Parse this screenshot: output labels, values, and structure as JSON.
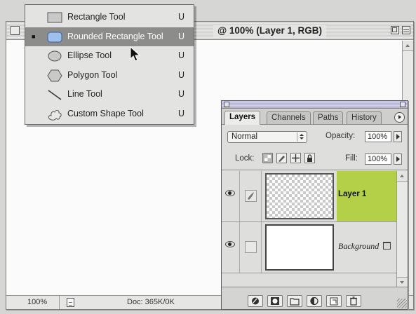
{
  "document": {
    "title_visible": "@ 100% (Layer 1, RGB)",
    "zoom": "100%",
    "doc_size": "Doc: 365K/0K"
  },
  "tool_menu": {
    "items": [
      {
        "label": "Rectangle Tool",
        "shortcut": "U",
        "icon": "rectangle-shape-icon",
        "selected": false
      },
      {
        "label": "Rounded Rectangle Tool",
        "shortcut": "U",
        "icon": "rounded-rectangle-shape-icon",
        "selected": true,
        "check": "■"
      },
      {
        "label": "Ellipse Tool",
        "shortcut": "U",
        "icon": "ellipse-shape-icon",
        "selected": false
      },
      {
        "label": "Polygon Tool",
        "shortcut": "U",
        "icon": "polygon-shape-icon",
        "selected": false
      },
      {
        "label": "Line Tool",
        "shortcut": "U",
        "icon": "line-shape-icon",
        "selected": false
      },
      {
        "label": "Custom Shape Tool",
        "shortcut": "U",
        "icon": "custom-shape-icon",
        "selected": false
      }
    ]
  },
  "layers_panel": {
    "tabs": [
      "Layers",
      "Channels",
      "Paths",
      "History"
    ],
    "active_tab": "Layers",
    "blend_mode": "Normal",
    "opacity_label": "Opacity:",
    "opacity_value": "100%",
    "lock_label": "Lock:",
    "fill_label": "Fill:",
    "fill_value": "100%",
    "layers": [
      {
        "name": "Layer 1",
        "selected": true,
        "thumbnail": "transparent",
        "visible": true
      },
      {
        "name": "Background",
        "selected": false,
        "thumbnail": "white",
        "visible": true,
        "locked": true
      }
    ]
  },
  "colors": {
    "selected_layer": "#b4cf48",
    "menu_highlight": "#8c8c8a",
    "panel_bg": "#dededc"
  }
}
